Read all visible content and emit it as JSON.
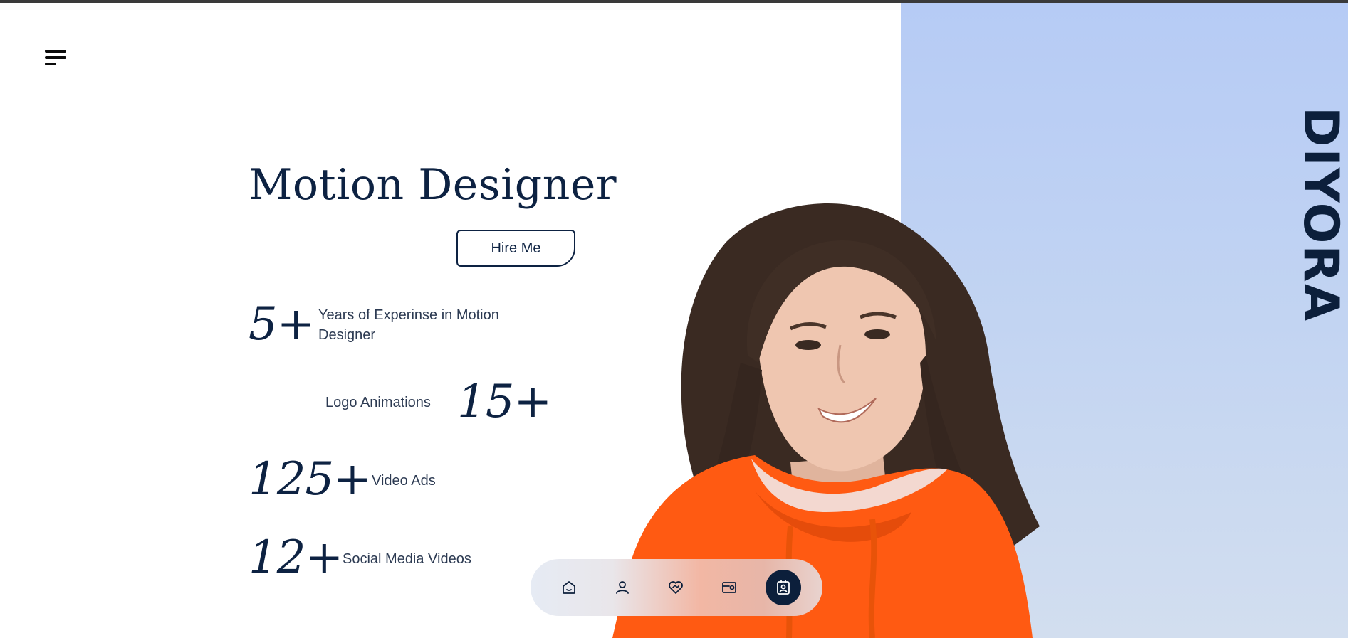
{
  "brand": "DIYORA",
  "hero": {
    "title": "Motion Designer",
    "hire_label": "Hire Me"
  },
  "stats": [
    {
      "number": "5+",
      "label": "Years of Experinse in Motion Designer"
    },
    {
      "number": "15+",
      "label": "Logo Animations"
    },
    {
      "number": "125+",
      "label": "Video Ads"
    },
    {
      "number": "12+",
      "label": "Social Media Videos"
    }
  ],
  "dock": {
    "items": [
      {
        "icon": "home-icon",
        "active": false
      },
      {
        "icon": "user-icon",
        "active": false
      },
      {
        "icon": "heart-handshake-icon",
        "active": false
      },
      {
        "icon": "portfolio-icon",
        "active": false
      },
      {
        "icon": "contact-icon",
        "active": true
      }
    ]
  },
  "colors": {
    "navy": "#0d2242",
    "panel_blue": "#b6cbf5",
    "hoodie_orange": "#ff5a12"
  }
}
